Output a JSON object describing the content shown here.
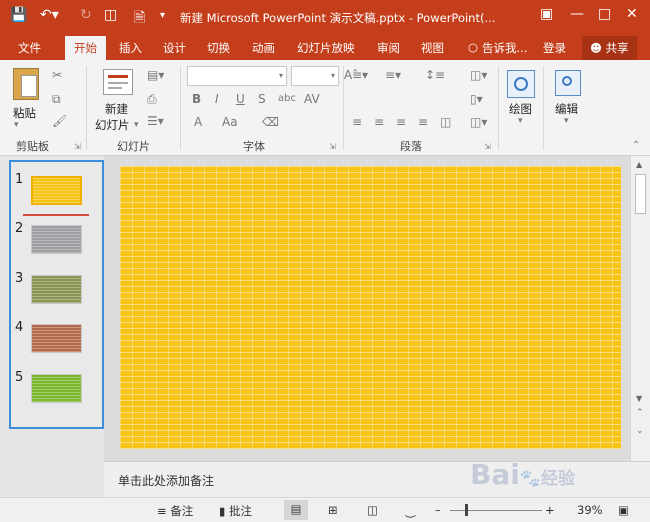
{
  "window": {
    "title": "新建 Microsoft PowerPoint 演示文稿.pptx - PowerPoint(..."
  },
  "tabs": [
    "文件",
    "开始",
    "插入",
    "设计",
    "切换",
    "动画",
    "幻灯片放映",
    "审阅",
    "视图"
  ],
  "active_tab": "开始",
  "tell_me": "告诉我...",
  "login": "登录",
  "share": "共享",
  "ribbon": {
    "clipboard": {
      "paste_label": "粘贴",
      "group_label": "剪贴板"
    },
    "slides": {
      "new_slide_line1": "新建",
      "new_slide_line2": "幻灯片",
      "group_label": "幻灯片"
    },
    "font": {
      "group_label": "字体",
      "bold": "B",
      "italic": "I",
      "underline": "U",
      "shadow": "S",
      "strike": "abc",
      "spacing": "AV",
      "color": "A",
      "case": "Aa"
    },
    "paragraph": {
      "group_label": "段落"
    },
    "drawing": {
      "label": "绘图"
    },
    "editing": {
      "label": "编辑"
    }
  },
  "thumbnails": [
    {
      "num": "1",
      "color": "#f5c416"
    },
    {
      "num": "2",
      "color": "#9d9da2"
    },
    {
      "num": "3",
      "color": "#8a9450"
    },
    {
      "num": "4",
      "color": "#b26a48"
    },
    {
      "num": "5",
      "color": "#7cb82e"
    }
  ],
  "notes_placeholder": "单击此处添加备注",
  "status": {
    "notes": "备注",
    "comments": "批注",
    "zoom": "39%"
  },
  "watermark": {
    "main": "Bai",
    "sub": "经验"
  },
  "colors": {
    "accent": "#c43e1c",
    "selection": "#3d8fdc",
    "slide": "#f5c416"
  }
}
